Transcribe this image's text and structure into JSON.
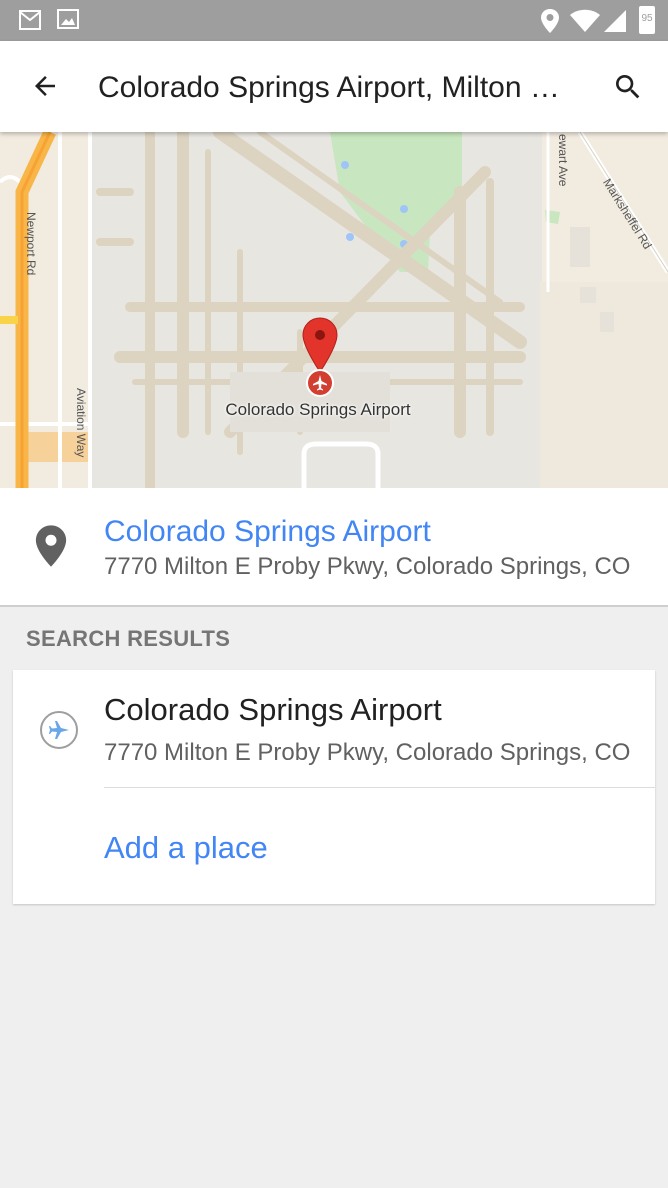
{
  "status_bar": {
    "icons": [
      "gmail-icon",
      "image-icon",
      "location-icon",
      "wifi-icon",
      "signal-icon",
      "battery-icon"
    ],
    "battery_level": "95"
  },
  "app_bar": {
    "title": "Colorado Springs Airport, Milton E Proby Pkwy",
    "back_icon": "arrow-back-icon",
    "search_icon": "search-icon"
  },
  "map": {
    "marker_label": "Colorado Springs Airport",
    "street_labels": {
      "newport": "Newport Rd",
      "aviation": "Aviation Way",
      "stewart": "ewart Ave",
      "marksheffel": "Marksheffel Rd"
    }
  },
  "place_card": {
    "name": "Colorado Springs Airport",
    "address": "7770 Milton E Proby Pkwy, Colorado Springs, CO"
  },
  "search_results": {
    "header": "SEARCH RESULTS",
    "items": [
      {
        "name": "Colorado Springs Airport",
        "address": "7770 Milton E Proby Pkwy, Colorado Springs, CO"
      }
    ],
    "add_place_label": "Add a place"
  },
  "colors": {
    "accent": "#4285f4",
    "status_bar": "#9e9e9e",
    "background": "#efefef"
  }
}
